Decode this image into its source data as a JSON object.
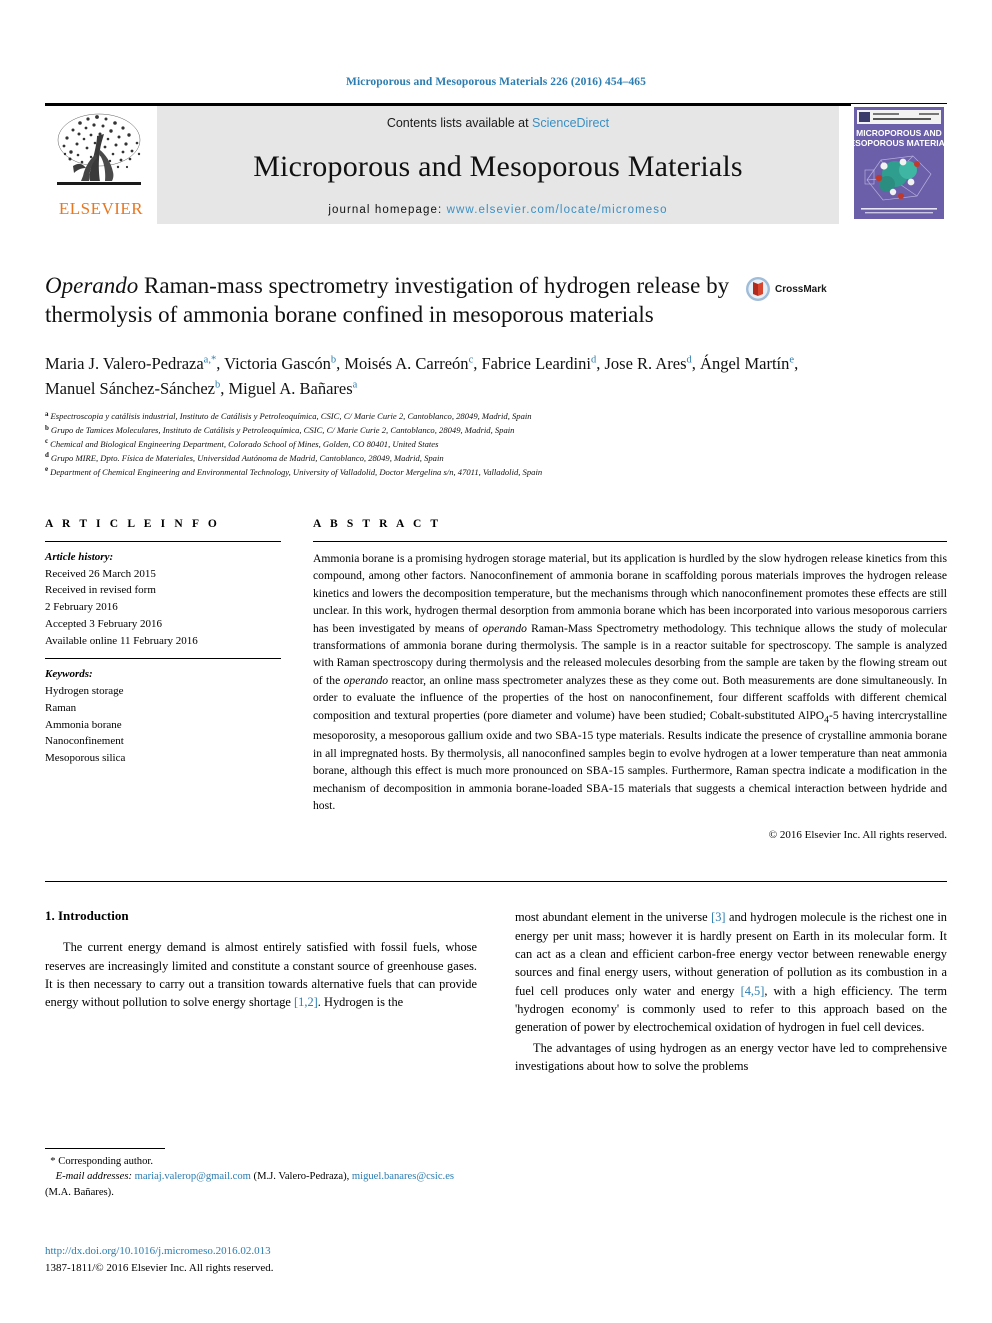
{
  "running_head": "Microporous and Mesoporous Materials 226 (2016) 454–465",
  "masthead": {
    "contents_prefix": "Contents lists available at ",
    "sciencedirect": "ScienceDirect",
    "journal_title": "Microporous and Mesoporous Materials",
    "homepage_prefix": "journal homepage: ",
    "homepage_url": "www.elsevier.com/locate/micromeso",
    "publisher": "ELSEVIER",
    "cover_title_line1": "MICROPOROUS AND",
    "cover_title_line2": "MESOPOROUS MATERIALS",
    "accent_link_color": "#3a8fc4",
    "publisher_color": "#e87722",
    "cover_color": "#6a5fa8"
  },
  "crossmark": {
    "label": "CrossMark",
    "icon": "crossmark-icon"
  },
  "title": {
    "italic_lead": "Operando",
    "rest": " Raman-mass spectrometry investigation of hydrogen release by thermolysis of ammonia borane confined in mesoporous materials"
  },
  "authors": {
    "line1": [
      {
        "name": "Maria J. Valero-Pedraza",
        "marks": "a,*"
      },
      {
        "name": "Victoria Gascón",
        "marks": "b"
      },
      {
        "name": "Moisés A. Carreón",
        "marks": "c"
      },
      {
        "name": "Fabrice Leardini",
        "marks": "d"
      }
    ],
    "line2": [
      {
        "name": "Jose R. Ares",
        "marks": "d"
      },
      {
        "name": "Ángel Martín",
        "marks": "e"
      },
      {
        "name": "Manuel Sánchez-Sánchez",
        "marks": "b"
      },
      {
        "name": "Miguel A. Bañares",
        "marks": "a"
      }
    ]
  },
  "affiliations": [
    {
      "mark": "a",
      "text": "Espectroscopia y catálisis industrial, Instituto de Catálisis y Petroleoquímica, CSIC, C/ Marie Curie 2, Cantoblanco, 28049, Madrid, Spain"
    },
    {
      "mark": "b",
      "text": "Grupo de Tamices Moleculares, Instituto de Catálisis y Petroleoquímica, CSIC, C/ Marie Curie 2, Cantoblanco, 28049, Madrid, Spain"
    },
    {
      "mark": "c",
      "text": "Chemical and Biological Engineering Department, Colorado School of Mines, Golden, CO 80401, United States"
    },
    {
      "mark": "d",
      "text": "Grupo MIRE, Dpto. Física de Materiales, Universidad Autónoma de Madrid, Cantoblanco, 28049, Madrid, Spain"
    },
    {
      "mark": "e",
      "text": "Department of Chemical Engineering and Environmental Technology, University of Valladolid, Doctor Mergelina s/n, 47011, Valladolid, Spain"
    }
  ],
  "article_info": {
    "heading": "A R T I C L E   I N F O",
    "history_label": "Article history:",
    "history": [
      "Received 26 March 2015",
      "Received in revised form",
      "2 February 2016",
      "Accepted 3 February 2016",
      "Available online 11 February 2016"
    ],
    "keywords_label": "Keywords:",
    "keywords": [
      "Hydrogen storage",
      "Raman",
      "Ammonia borane",
      "Nanoconfinement",
      "Mesoporous silica"
    ]
  },
  "abstract": {
    "heading": "A B S T R A C T",
    "part1": "Ammonia borane is a promising hydrogen storage material, but its application is hurdled by the slow hydrogen release kinetics from this compound, among other factors. Nanoconfinement of ammonia borane in scaffolding porous materials improves the hydrogen release kinetics and lowers the decomposition temperature, but the mechanisms through which nanoconfinement promotes these effects are still unclear. In this work, hydrogen thermal desorption from ammonia borane which has been incorporated into various mesoporous carriers has been investigated by means of ",
    "italic1": "operando",
    "part2": " Raman-Mass Spectrometry methodology. This technique allows the study of molecular transformations of ammonia borane during thermolysis. The sample is in a reactor suitable for spectroscopy. The sample is analyzed with Raman spectroscopy during thermolysis and the released molecules desorbing from the sample are taken by the flowing stream out of the ",
    "italic2": "operando",
    "part3": " reactor, an online mass spectrometer analyzes these as they come out. Both measurements are done simultaneously. In order to evaluate the influence of the properties of the host on nanoconfinement, four different scaffolds with different chemical composition and textural properties (pore diameter and volume) have been studied; Cobalt-substituted AlPO",
    "subscript": "4",
    "part4": "-5 having intercrystalline mesoporosity, a mesoporous gallium oxide and two SBA-15 type materials. Results indicate the presence of crystalline ammonia borane in all impregnated hosts. By thermolysis, all nanoconfined samples begin to evolve hydrogen at a lower temperature than neat ammonia borane, although this effect is much more pronounced on SBA-15 samples. Furthermore, Raman spectra indicate a modification in the mechanism of decomposition in ammonia borane-loaded SBA-15 materials that suggests a chemical interaction between hydride and host.",
    "copyright": "© 2016 Elsevier Inc. All rights reserved."
  },
  "introduction": {
    "heading": "1. Introduction",
    "left_para_1_a": "The current energy demand is almost entirely satisfied with fossil fuels, whose reserves are increasingly limited and constitute a constant source of greenhouse gases. It is then necessary to carry out a transition towards alternative fuels that can provide energy without pollution to solve energy shortage ",
    "left_ref_1": "[1,2]",
    "left_para_1_b": ". Hydrogen is the",
    "right_para_1_a": "most abundant element in the universe ",
    "right_ref_1": "[3]",
    "right_para_1_b": " and hydrogen molecule is the richest one in energy per unit mass; however it is hardly present on Earth in its molecular form. It can act as a clean and efficient carbon-free energy vector between renewable energy sources and final energy users, without generation of pollution as its combustion in a fuel cell produces only water and energy ",
    "right_ref_2": "[4,5]",
    "right_para_1_c": ", with a high efficiency. The term 'hydrogen economy' is commonly used to refer to this approach based on the generation of power by electrochemical oxidation of hydrogen in fuel cell devices.",
    "right_para_2": "The advantages of using hydrogen as an energy vector have led to comprehensive investigations about how to solve the problems"
  },
  "footnotes": {
    "corresponding_mark": "*",
    "corresponding_text": "Corresponding author.",
    "email_label": "E-mail addresses:",
    "email1": "mariaj.valerop@gmail.com",
    "email1_owner": " (M.J. Valero-Pedraza), ",
    "email2": "miguel.banares@csic.es",
    "email2_owner": " (M.A. Bañares)."
  },
  "doi_block": {
    "doi_url": "http://dx.doi.org/10.1016/j.micromeso.2016.02.013",
    "issn_line": "1387-1811/© 2016 Elsevier Inc. All rights reserved."
  }
}
